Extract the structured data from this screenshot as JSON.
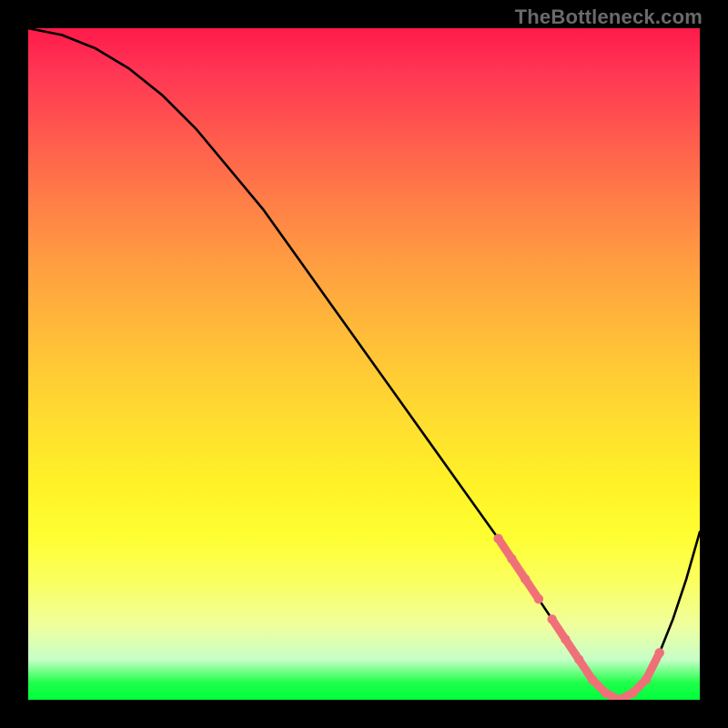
{
  "attribution": "TheBottleneck.com",
  "chart_data": {
    "type": "line",
    "title": "",
    "xlabel": "",
    "ylabel": "",
    "grid": false,
    "legend": false,
    "x": [
      0,
      5,
      10,
      15,
      20,
      25,
      30,
      35,
      40,
      45,
      50,
      55,
      60,
      65,
      70,
      72,
      74,
      76,
      78,
      80,
      82,
      84,
      86,
      88,
      90,
      92,
      94,
      96,
      98,
      100
    ],
    "values": [
      100,
      99,
      97,
      94,
      90,
      85,
      79,
      73,
      66,
      59,
      52,
      45,
      38,
      31,
      24,
      21,
      18,
      15,
      12,
      9,
      6,
      3,
      1,
      0,
      1,
      3,
      7,
      12,
      18,
      25
    ],
    "xlim": [
      0,
      100
    ],
    "ylim": [
      0,
      100
    ],
    "highlight_segments": [
      {
        "x": [
          70,
          72,
          74,
          76
        ],
        "values": [
          24,
          21,
          18,
          15
        ]
      },
      {
        "x": [
          78,
          80,
          82,
          84,
          86,
          88,
          90
        ],
        "values": [
          12,
          9,
          6,
          3,
          1,
          0,
          1
        ]
      },
      {
        "x": [
          90,
          92,
          94
        ],
        "values": [
          1,
          3,
          7
        ]
      }
    ],
    "highlight_color": "#f07078"
  },
  "colors": {
    "background": "#000000",
    "curve": "#000000",
    "highlight": "#f07078"
  }
}
